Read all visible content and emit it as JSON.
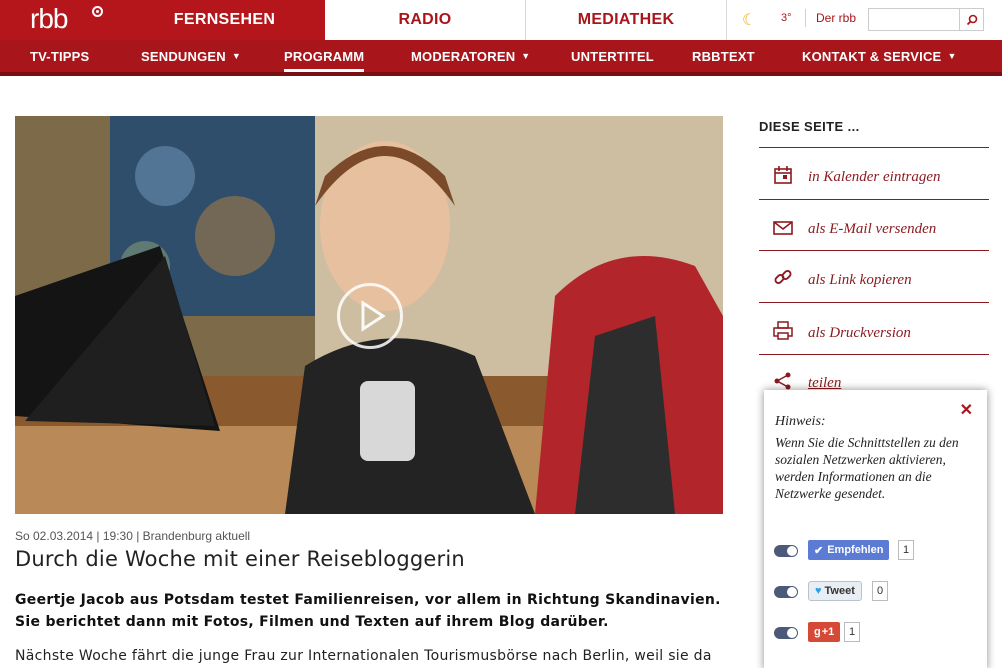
{
  "header": {
    "logo_text": "rbb",
    "tabs": [
      "FERNSEHEN",
      "RADIO",
      "MEDIATHEK"
    ],
    "weather_temp": "3°",
    "der_rbb": "Der rbb",
    "search_placeholder": ""
  },
  "subnav": [
    {
      "label": "TV-TIPPS",
      "caret": ""
    },
    {
      "label": "SENDUNGEN",
      "caret": "▼"
    },
    {
      "label": "PROGRAMM",
      "caret": ""
    },
    {
      "label": "MODERATOREN",
      "caret": "▼"
    },
    {
      "label": "UNTERTITEL",
      "caret": ""
    },
    {
      "label": "RBBTEXT",
      "caret": ""
    },
    {
      "label": "KONTAKT & SERVICE",
      "caret": "▼"
    }
  ],
  "article": {
    "meta": "So 02.03.2014 | 19:30 | Brandenburg aktuell",
    "title": "Durch die Woche mit einer Reisebloggerin",
    "lead": "Geertje Jacob aus Potsdam testet Familienreisen, vor allem in Richtung Skandinavien. Sie berichtet dann mit Fotos, Filmen und Texten auf ihrem Blog darüber.",
    "body": "Nächste Woche fährt die junge Frau zur Internationalen Tourismusbörse nach Berlin, weil sie da"
  },
  "sidebar": {
    "heading": "DIESE SEITE ...",
    "items": [
      {
        "label": "in Kalender eintragen",
        "icon": "calendar-icon"
      },
      {
        "label": "als E-Mail versenden",
        "icon": "mail-icon"
      },
      {
        "label": "als Link kopieren",
        "icon": "link-icon"
      },
      {
        "label": "als Druckversion",
        "icon": "printer-icon"
      },
      {
        "label": "teilen",
        "icon": "share-icon"
      }
    ]
  },
  "popup": {
    "heading": "Hinweis:",
    "text": "Wenn Sie die Schnittstellen zu den sozialen Netzwerken aktivieren, werden Informationen an die Netzwerke gesendet.",
    "close": "✕",
    "social": [
      {
        "label": "Empfehlen",
        "count": "1",
        "color": "#5b7bd5"
      },
      {
        "label": "Tweet",
        "count": "0",
        "color": "#e8eef4"
      },
      {
        "label": "+1",
        "count": "1",
        "color": "#d64937"
      }
    ]
  },
  "colors": {
    "brand": "#b5161b",
    "brand_dark": "#a8161b"
  }
}
